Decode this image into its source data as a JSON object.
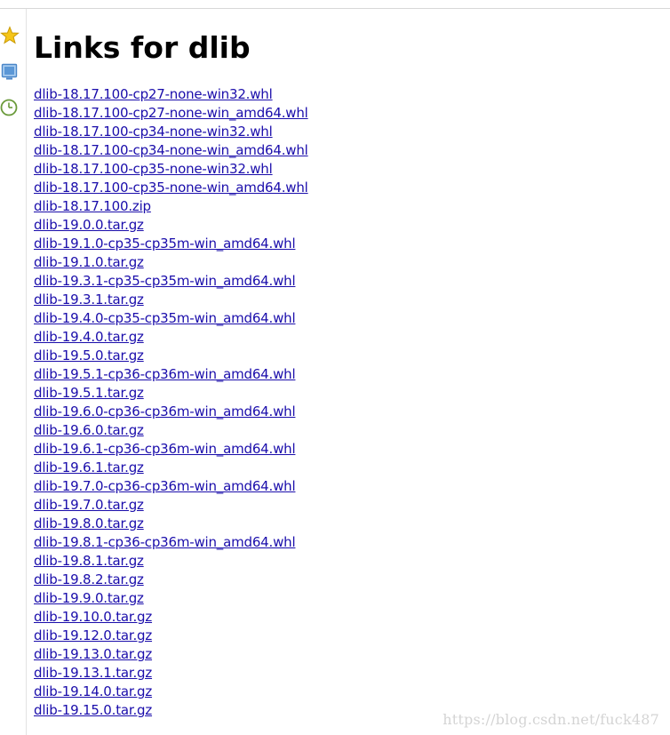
{
  "sidebar": {
    "icons": [
      "star-icon",
      "monitor-icon",
      "clock-icon"
    ]
  },
  "page": {
    "title": "Links for dlib",
    "links": [
      "dlib-18.17.100-cp27-none-win32.whl",
      "dlib-18.17.100-cp27-none-win_amd64.whl",
      "dlib-18.17.100-cp34-none-win32.whl",
      "dlib-18.17.100-cp34-none-win_amd64.whl",
      "dlib-18.17.100-cp35-none-win32.whl",
      "dlib-18.17.100-cp35-none-win_amd64.whl",
      "dlib-18.17.100.zip",
      "dlib-19.0.0.tar.gz",
      "dlib-19.1.0-cp35-cp35m-win_amd64.whl",
      "dlib-19.1.0.tar.gz",
      "dlib-19.3.1-cp35-cp35m-win_amd64.whl",
      "dlib-19.3.1.tar.gz",
      "dlib-19.4.0-cp35-cp35m-win_amd64.whl",
      "dlib-19.4.0.tar.gz",
      "dlib-19.5.0.tar.gz",
      "dlib-19.5.1-cp36-cp36m-win_amd64.whl",
      "dlib-19.5.1.tar.gz",
      "dlib-19.6.0-cp36-cp36m-win_amd64.whl",
      "dlib-19.6.0.tar.gz",
      "dlib-19.6.1-cp36-cp36m-win_amd64.whl",
      "dlib-19.6.1.tar.gz",
      "dlib-19.7.0-cp36-cp36m-win_amd64.whl",
      "dlib-19.7.0.tar.gz",
      "dlib-19.8.0.tar.gz",
      "dlib-19.8.1-cp36-cp36m-win_amd64.whl",
      "dlib-19.8.1.tar.gz",
      "dlib-19.8.2.tar.gz",
      "dlib-19.9.0.tar.gz",
      "dlib-19.10.0.tar.gz",
      "dlib-19.12.0.tar.gz",
      "dlib-19.13.0.tar.gz",
      "dlib-19.13.1.tar.gz",
      "dlib-19.14.0.tar.gz",
      "dlib-19.15.0.tar.gz"
    ]
  },
  "watermark": "https://blog.csdn.net/fuck487",
  "colors": {
    "link": "#1a0dab",
    "star": "#f5c518",
    "monitor": "#4a86c8",
    "clock": "#6a9a3a"
  }
}
